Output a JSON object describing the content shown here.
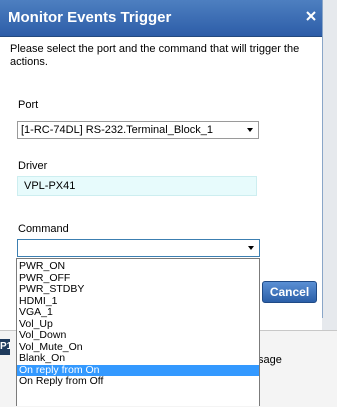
{
  "dialog": {
    "title": "Monitor Events Trigger",
    "close_symbol": "×",
    "instructions": "Please select the port and the command that will trigger the actions.",
    "port": {
      "label": "Port",
      "value": "[1-RC-74DL] RS-232.Terminal_Block_1"
    },
    "driver": {
      "label": "Driver",
      "value": "VPL-PX41"
    },
    "command": {
      "label": "Command",
      "value": "",
      "options": [
        "PWR_ON",
        "PWR_OFF",
        "PWR_STDBY",
        "HDMI_1",
        "VGA_1",
        "Vol_Up",
        "Vol_Down",
        "Vol_Mute_On",
        "Blank_On",
        "On reply from On",
        "On Reply from Off"
      ],
      "highlighted_index": 9
    },
    "cancel_label": "Cancel"
  },
  "background": {
    "left_label": "P1",
    "right_text": "sage"
  },
  "colors": {
    "titlebar": "#2d5da8",
    "selection": "#3399ff",
    "readonly_bg": "#e7fbfc"
  }
}
